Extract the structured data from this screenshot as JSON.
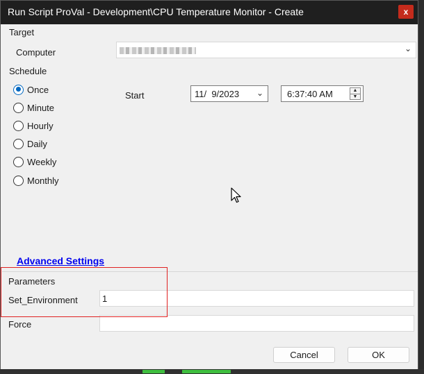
{
  "window": {
    "title": "Run Script ProVal - Development\\CPU Temperature Monitor - Create",
    "close_label": "x"
  },
  "target": {
    "section_label": "Target",
    "computer_label": "Computer",
    "computer_value": ""
  },
  "schedule": {
    "section_label": "Schedule",
    "options": [
      {
        "label": "Once",
        "checked": true
      },
      {
        "label": "Minute",
        "checked": false
      },
      {
        "label": "Hourly",
        "checked": false
      },
      {
        "label": "Daily",
        "checked": false
      },
      {
        "label": "Weekly",
        "checked": false
      },
      {
        "label": "Monthly",
        "checked": false
      }
    ],
    "start_label": "Start",
    "start_date": "11/  9/2023",
    "start_time": "6:37:40 AM"
  },
  "advanced_settings_link": "Advanced Settings",
  "parameters": {
    "section_label": "Parameters",
    "rows": [
      {
        "label": "Set_Environment",
        "value": "1"
      },
      {
        "label": "Force",
        "value": ""
      }
    ]
  },
  "footer": {
    "cancel_label": "Cancel",
    "ok_label": "OK"
  },
  "colors": {
    "accent": "#0067c0",
    "close": "#c42b1c",
    "highlight": "#e02020",
    "link": "#0000ee"
  }
}
